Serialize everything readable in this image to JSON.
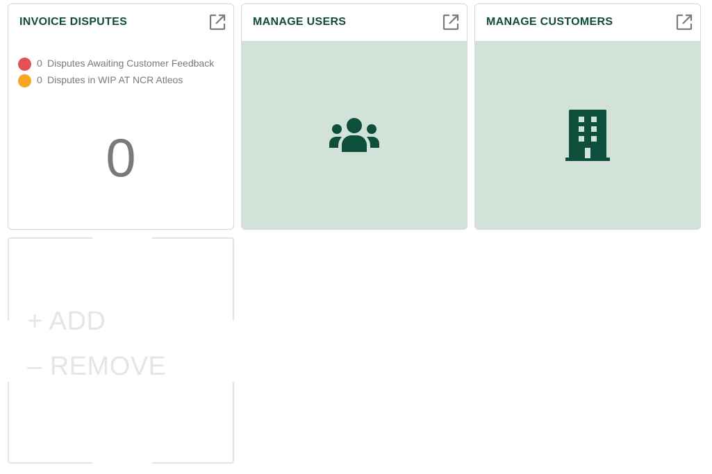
{
  "cards": [
    {
      "title": "INVOICE DISPUTES",
      "open_icon": "external-link-icon",
      "legend": [
        {
          "count": "0",
          "label": "Disputes Awaiting Customer Feedback",
          "color": "#e05258"
        },
        {
          "count": "0",
          "label": "Disputes in WIP AT NCR Atleos",
          "color": "#f5a623"
        }
      ],
      "total": "0"
    },
    {
      "title": "MANAGE USERS",
      "open_icon": "external-link-icon",
      "icon": "users-group-icon"
    },
    {
      "title": "MANAGE CUSTOMERS",
      "open_icon": "external-link-icon",
      "icon": "building-icon"
    }
  ],
  "editor": {
    "add_label": "+ ADD",
    "remove_label": "– REMOVE"
  },
  "colors": {
    "title": "#0f4c3a",
    "icon": "#0d4f3c",
    "tile_bg": "#d2e2d8",
    "red": "#e05258",
    "amber": "#f5a623"
  }
}
